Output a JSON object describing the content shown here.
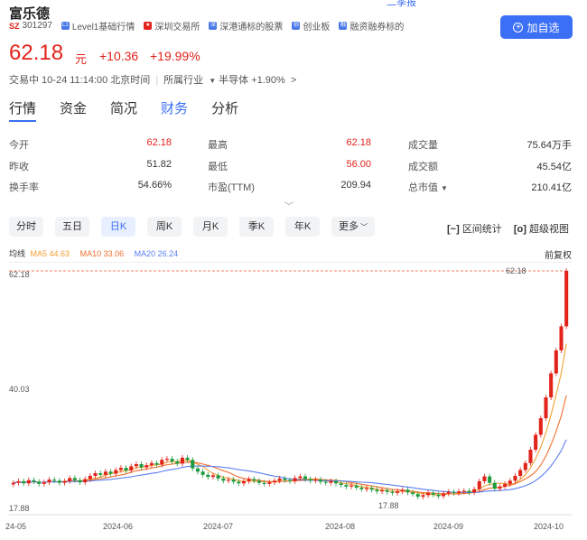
{
  "header": {
    "top_link": "二季报",
    "stock_name": "富乐德",
    "market_tag": "SZ",
    "code": "301297",
    "tags": [
      {
        "icon": "L1",
        "label": "Level1基础行情",
        "color": "#4a78e8"
      },
      {
        "icon": "flag-icon",
        "label": "深圳交易所",
        "color": "#e2231a"
      },
      {
        "icon": "深",
        "label": "深港通标的股票",
        "color": "#4a78e8"
      },
      {
        "icon": "创",
        "label": "创业板",
        "color": "#4a78e8"
      },
      {
        "icon": "融",
        "label": "融资融券标的",
        "color": "#4a78e8"
      }
    ],
    "add_button": "加自选",
    "price": "62.18",
    "unit": "元",
    "change": "+10.36",
    "change_pct": "+19.99%",
    "status": "交易中 10-24 11:14:00 北京时间",
    "industry": "所属行业",
    "sector": "半导体 +1.90%",
    "sector_arrow": ">"
  },
  "tabs": [
    "行情",
    "资金",
    "简况",
    "财务",
    "分析"
  ],
  "quote": {
    "rows": [
      [
        [
          "今开",
          "62.18"
        ],
        [
          "最高",
          "62.18"
        ],
        [
          "成交量",
          "75.64万手"
        ]
      ],
      [
        [
          "昨收",
          "51.82"
        ],
        [
          "最低",
          "56.00"
        ],
        [
          "成交额",
          "45.54亿"
        ]
      ],
      [
        [
          "换手率",
          "54.66%"
        ],
        [
          "市盈(TTM)",
          "209.94"
        ],
        [
          "总市值",
          "210.41亿"
        ]
      ]
    ],
    "expand_icon": "chevron-down-icon"
  },
  "periods": [
    "分时",
    "五日",
    "日K",
    "周K",
    "月K",
    "季K",
    "年K",
    "更多"
  ],
  "tools": {
    "interval": "区间统计",
    "super": "超级视图"
  },
  "ma_legend": {
    "label": "均线",
    "ma5": "MA5 44.63",
    "ma10": "MA10 33.06",
    "ma20": "MA20 26.24",
    "fq": "前复权"
  },
  "colors": {
    "up": "#e2231a",
    "down": "#1f9b3f",
    "ma5": "#f0a030",
    "ma10": "#f07030",
    "ma20": "#5b7ff0",
    "accent": "#3b6ff5"
  },
  "chart_data": {
    "type": "candlestick",
    "title": "",
    "x_ticks": [
      "24-05",
      "2024-06",
      "2024-07",
      "2024-08",
      "2024-09",
      "2024-10"
    ],
    "y_ticks": [
      "62.18",
      "40.03",
      "17.88"
    ],
    "max_label": "62.18",
    "min_label": "17.88",
    "ylim": [
      17.88,
      62.18
    ],
    "closes": [
      22.5,
      22.8,
      22.4,
      23.0,
      22.7,
      22.3,
      22.6,
      23.1,
      22.9,
      22.5,
      22.8,
      23.4,
      23.0,
      22.6,
      23.2,
      23.8,
      24.3,
      24.0,
      24.6,
      24.2,
      24.9,
      25.3,
      24.8,
      25.6,
      26.0,
      25.4,
      25.8,
      26.2,
      25.9,
      26.8,
      27.0,
      26.5,
      26.1,
      27.2,
      26.8,
      25.2,
      24.6,
      24.0,
      23.6,
      23.9,
      23.3,
      22.9,
      23.1,
      22.7,
      22.4,
      22.8,
      23.2,
      22.9,
      22.5,
      22.3,
      22.6,
      22.9,
      23.3,
      23.0,
      22.8,
      23.4,
      23.7,
      23.2,
      22.9,
      23.1,
      22.7,
      22.5,
      22.8,
      22.4,
      22.1,
      21.8,
      22.0,
      21.6,
      21.3,
      21.5,
      21.2,
      20.9,
      21.1,
      20.8,
      20.6,
      20.9,
      21.2,
      20.7,
      20.4,
      19.9,
      20.2,
      20.6,
      20.3,
      20.0,
      20.5,
      20.8,
      20.6,
      20.9,
      21.0,
      20.7,
      21.3,
      22.8,
      23.7,
      22.5,
      21.4,
      21.8,
      22.3,
      22.9,
      23.8,
      24.9,
      26.2,
      28.7,
      31.5,
      34.6,
      38.5,
      43.0,
      47.3,
      51.8,
      62.18
    ],
    "ma5_last": 44.63,
    "ma10_last": 33.06,
    "ma20_last": 26.24
  }
}
